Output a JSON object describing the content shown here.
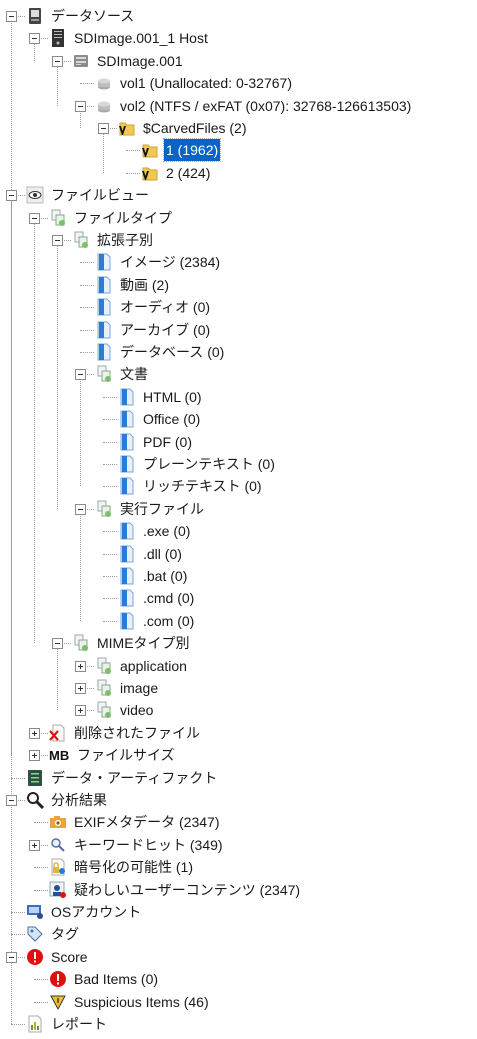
{
  "tree": [
    {
      "key": "datasource",
      "label": "データソース",
      "depth": 0,
      "exp": "minus",
      "icon": "drive-icon"
    },
    {
      "key": "host",
      "label": "SDImage.001_1 Host",
      "depth": 1,
      "exp": "minus",
      "icon": "host-icon"
    },
    {
      "key": "image",
      "label": "SDImage.001",
      "depth": 2,
      "exp": "minus",
      "icon": "disk-image-icon"
    },
    {
      "key": "vol1",
      "label": "vol1 (Unallocated: 0-32767)",
      "depth": 3,
      "exp": "none",
      "icon": "volume-icon"
    },
    {
      "key": "vol2",
      "label": "vol2 (NTFS / exFAT (0x07): 32768-126613503)",
      "depth": 3,
      "exp": "minus",
      "icon": "volume-icon"
    },
    {
      "key": "carved",
      "label": "$CarvedFiles (2)",
      "depth": 4,
      "exp": "minus",
      "icon": "carved-folder-icon"
    },
    {
      "key": "carved1",
      "label": "1 (1962)",
      "depth": 5,
      "exp": "none",
      "icon": "carved-folder-icon",
      "selected": true
    },
    {
      "key": "carved2",
      "label": "2 (424)",
      "depth": 5,
      "exp": "none",
      "icon": "carved-folder-icon"
    },
    {
      "key": "fileview",
      "label": "ファイルビュー",
      "depth": 0,
      "exp": "minus",
      "icon": "eye-icon"
    },
    {
      "key": "filetype",
      "label": "ファイルタイプ",
      "depth": 1,
      "exp": "minus",
      "icon": "file-types-icon"
    },
    {
      "key": "byext",
      "label": "拡張子別",
      "depth": 2,
      "exp": "minus",
      "icon": "file-types-icon"
    },
    {
      "key": "images",
      "label": "イメージ (2384)",
      "depth": 3,
      "exp": "none",
      "icon": "document-icon"
    },
    {
      "key": "videos",
      "label": "動画 (2)",
      "depth": 3,
      "exp": "none",
      "icon": "document-icon"
    },
    {
      "key": "audio",
      "label": "オーディオ (0)",
      "depth": 3,
      "exp": "none",
      "icon": "document-icon"
    },
    {
      "key": "archives",
      "label": "アーカイブ (0)",
      "depth": 3,
      "exp": "none",
      "icon": "document-icon"
    },
    {
      "key": "databases",
      "label": "データベース (0)",
      "depth": 3,
      "exp": "none",
      "icon": "document-icon"
    },
    {
      "key": "documents",
      "label": "文書",
      "depth": 3,
      "exp": "minus",
      "icon": "file-types-icon"
    },
    {
      "key": "html",
      "label": "HTML (0)",
      "depth": 4,
      "exp": "none",
      "icon": "document-icon"
    },
    {
      "key": "office",
      "label": "Office (0)",
      "depth": 4,
      "exp": "none",
      "icon": "document-icon"
    },
    {
      "key": "pdf",
      "label": "PDF (0)",
      "depth": 4,
      "exp": "none",
      "icon": "document-icon"
    },
    {
      "key": "plaintext",
      "label": "プレーンテキスト (0)",
      "depth": 4,
      "exp": "none",
      "icon": "document-icon"
    },
    {
      "key": "richtext",
      "label": "リッチテキスト (0)",
      "depth": 4,
      "exp": "none",
      "icon": "document-icon"
    },
    {
      "key": "executables",
      "label": "実行ファイル",
      "depth": 3,
      "exp": "minus",
      "icon": "file-types-icon"
    },
    {
      "key": "exe",
      "label": ".exe (0)",
      "depth": 4,
      "exp": "none",
      "icon": "document-icon"
    },
    {
      "key": "dll",
      "label": ".dll (0)",
      "depth": 4,
      "exp": "none",
      "icon": "document-icon"
    },
    {
      "key": "bat",
      "label": ".bat (0)",
      "depth": 4,
      "exp": "none",
      "icon": "document-icon"
    },
    {
      "key": "cmd",
      "label": ".cmd (0)",
      "depth": 4,
      "exp": "none",
      "icon": "document-icon"
    },
    {
      "key": "com",
      "label": ".com (0)",
      "depth": 4,
      "exp": "none",
      "icon": "document-icon"
    },
    {
      "key": "bymime",
      "label": "MIMEタイプ別",
      "depth": 2,
      "exp": "minus",
      "icon": "file-types-icon"
    },
    {
      "key": "application",
      "label": "application",
      "depth": 3,
      "exp": "plus",
      "icon": "file-types-icon"
    },
    {
      "key": "mimeimage",
      "label": "image",
      "depth": 3,
      "exp": "plus",
      "icon": "file-types-icon"
    },
    {
      "key": "video",
      "label": "video",
      "depth": 3,
      "exp": "plus",
      "icon": "file-types-icon"
    },
    {
      "key": "deleted",
      "label": "削除されたファイル",
      "depth": 1,
      "exp": "plus",
      "icon": "deleted-file-icon"
    },
    {
      "key": "filesize",
      "label": "ファイルサイズ",
      "depth": 1,
      "exp": "plus",
      "icon": "file-size-icon",
      "icon_text": "MB"
    },
    {
      "key": "artifacts",
      "label": "データ・アーティファクト",
      "depth": 0,
      "exp": "none",
      "icon": "artifacts-icon"
    },
    {
      "key": "analysis",
      "label": "分析結果",
      "depth": 0,
      "exp": "minus",
      "icon": "magnifier-icon"
    },
    {
      "key": "exif",
      "label": "EXIFメタデータ (2347)",
      "depth": 1,
      "exp": "none",
      "icon": "camera-icon"
    },
    {
      "key": "keyword",
      "label": "キーワードヒット (349)",
      "depth": 1,
      "exp": "plus",
      "icon": "keyword-search-icon"
    },
    {
      "key": "encryption",
      "label": "暗号化の可能性 (1)",
      "depth": 1,
      "exp": "none",
      "icon": "encrypted-file-icon"
    },
    {
      "key": "suspicious",
      "label": "疑わしいユーザーコンテンツ (2347)",
      "depth": 1,
      "exp": "none",
      "icon": "suspicious-user-icon"
    },
    {
      "key": "osaccounts",
      "label": "OSアカウント",
      "depth": 0,
      "exp": "none",
      "icon": "os-account-icon"
    },
    {
      "key": "tags",
      "label": "タグ",
      "depth": 0,
      "exp": "none",
      "icon": "tag-icon"
    },
    {
      "key": "score",
      "label": "Score",
      "depth": 0,
      "exp": "minus",
      "icon": "alert-red-icon"
    },
    {
      "key": "baditems",
      "label": "Bad Items (0)",
      "depth": 1,
      "exp": "none",
      "icon": "alert-red-icon"
    },
    {
      "key": "suspiciousitems",
      "label": "Suspicious Items (46)",
      "depth": 1,
      "exp": "none",
      "icon": "warning-yellow-icon"
    },
    {
      "key": "reports",
      "label": "レポート",
      "depth": 0,
      "exp": "none",
      "icon": "report-icon"
    }
  ],
  "colors": {
    "selection": "#0a64c8",
    "alert": "#e01010",
    "folder": "#f2c94c",
    "document": "#2a7bd3"
  }
}
